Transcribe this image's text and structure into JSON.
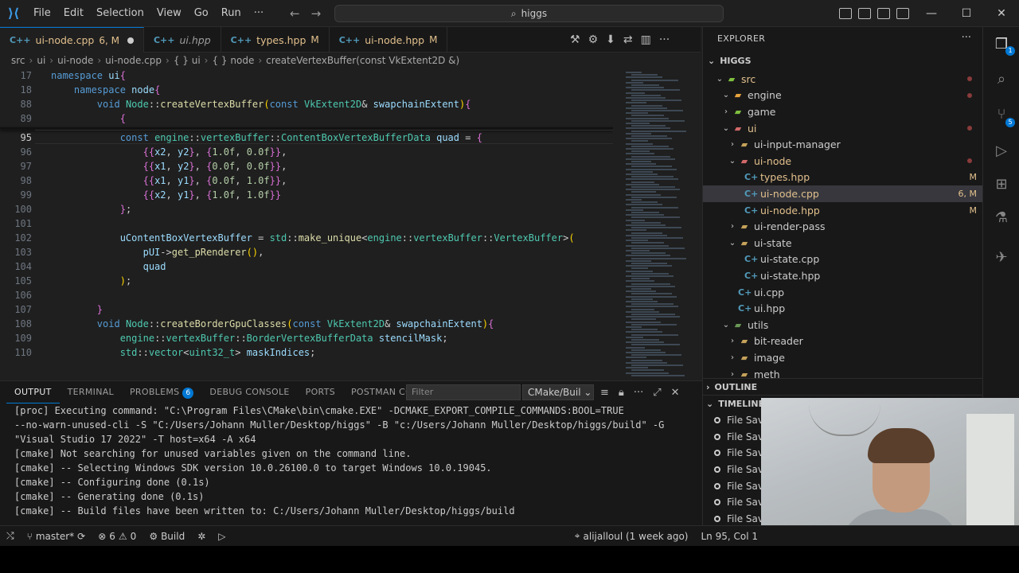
{
  "titlebar": {
    "menu": [
      "File",
      "Edit",
      "Selection",
      "View",
      "Go",
      "Run",
      "···"
    ],
    "search": "higgs"
  },
  "tabs": [
    {
      "label": "ui-node.cpp",
      "badge": "6, M",
      "icon": "C++",
      "active": true,
      "dirty": true
    },
    {
      "label": "ui.hpp",
      "badge": "",
      "icon": "C++",
      "active": false,
      "italic": true
    },
    {
      "label": "types.hpp",
      "badge": "M",
      "icon": "C++",
      "active": false
    },
    {
      "label": "ui-node.hpp",
      "badge": "M",
      "icon": "C++",
      "active": false
    }
  ],
  "breadcrumb": [
    "src",
    "ui",
    "ui-node",
    "ui-node.cpp",
    "{ } ui",
    "{ } node",
    "createVertexBuffer(const VkExtent2D &)"
  ],
  "editor": {
    "lines": [
      {
        "n": "17",
        "t": "namespace ui{"
      },
      {
        "n": "18",
        "t": "    namespace node{"
      },
      {
        "n": "88",
        "t": "        void Node::createVertexBuffer(const VkExtent2D& swapchainExtent){"
      },
      {
        "n": "89",
        "t": "            {"
      },
      {
        "n": "95",
        "t": "            const engine::vertexBuffer::ContentBoxVertexBufferData quad = {"
      },
      {
        "n": "96",
        "t": "                {{x2, y2}, {1.0f, 0.0f}},"
      },
      {
        "n": "97",
        "t": "                {{x1, y2}, {0.0f, 0.0f}},"
      },
      {
        "n": "98",
        "t": "                {{x1, y1}, {0.0f, 1.0f}},"
      },
      {
        "n": "99",
        "t": "                {{x2, y1}, {1.0f, 1.0f}}"
      },
      {
        "n": "100",
        "t": "            };"
      },
      {
        "n": "101",
        "t": ""
      },
      {
        "n": "102",
        "t": "            uContentBoxVertexBuffer = std::make_unique<engine::vertexBuffer::VertexBuffer>("
      },
      {
        "n": "103",
        "t": "                pUI->get_pRenderer(),"
      },
      {
        "n": "104",
        "t": "                quad"
      },
      {
        "n": "105",
        "t": "            );"
      },
      {
        "n": "106",
        "t": ""
      },
      {
        "n": "107",
        "t": "        }"
      },
      {
        "n": "108",
        "t": "        void Node::createBorderGpuClasses(const VkExtent2D& swapchainExtent){"
      },
      {
        "n": "109",
        "t": "            engine::vertexBuffer::BorderVertexBufferData stencilMask;"
      },
      {
        "n": "110",
        "t": "            std::vector<uint32_t> maskIndices;"
      }
    ]
  },
  "panel": {
    "tabs": [
      {
        "label": "OUTPUT",
        "active": true
      },
      {
        "label": "TERMINAL"
      },
      {
        "label": "PROBLEMS",
        "badge": "6"
      },
      {
        "label": "DEBUG CONSOLE"
      },
      {
        "label": "PORTS"
      },
      {
        "label": "POSTMAN CONSOLE"
      }
    ],
    "filter_placeholder": "Filter",
    "channel": "CMake/Buil",
    "output": [
      "[proc] Executing command: \"C:\\Program Files\\CMake\\bin\\cmake.EXE\" -DCMAKE_EXPORT_COMPILE_COMMANDS:BOOL=TRUE",
      "--no-warn-unused-cli -S \"C:/Users/Johann Muller/Desktop/higgs\" -B \"c:/Users/Johann Muller/Desktop/higgs/build\" -G",
      "\"Visual Studio 17 2022\" -T host=x64 -A x64",
      "[cmake] Not searching for unused variables given on the command line.",
      "[cmake] -- Selecting Windows SDK version 10.0.26100.0 to target Windows 10.0.19045.",
      "[cmake] -- Configuring done (0.1s)",
      "[cmake] -- Generating done (0.1s)",
      "[cmake] -- Build files have been written to: C:/Users/Johann Muller/Desktop/higgs/build"
    ]
  },
  "explorer": {
    "header": "EXPLORER",
    "root": "HIGGS",
    "tree": [
      {
        "label": "src",
        "kind": "folder",
        "depth": 1,
        "open": true,
        "dot": true
      },
      {
        "label": "engine",
        "kind": "folder",
        "depth": 2,
        "open": true,
        "dot": true
      },
      {
        "label": "game",
        "kind": "folder",
        "depth": 2,
        "open": false
      },
      {
        "label": "ui",
        "kind": "folder",
        "depth": 2,
        "open": true,
        "dot": true
      },
      {
        "label": "ui-input-manager",
        "kind": "folder",
        "depth": 3,
        "open": false
      },
      {
        "label": "ui-node",
        "kind": "folder",
        "depth": 3,
        "open": true,
        "dot": true
      },
      {
        "label": "types.hpp",
        "kind": "file",
        "depth": 4,
        "badge": "M"
      },
      {
        "label": "ui-node.cpp",
        "kind": "file",
        "depth": 4,
        "badge": "6, M",
        "selected": true
      },
      {
        "label": "ui-node.hpp",
        "kind": "file",
        "depth": 4,
        "badge": "M"
      },
      {
        "label": "ui-render-pass",
        "kind": "folder",
        "depth": 3,
        "open": false
      },
      {
        "label": "ui-state",
        "kind": "folder",
        "depth": 3,
        "open": true
      },
      {
        "label": "ui-state.cpp",
        "kind": "file",
        "depth": 4
      },
      {
        "label": "ui-state.hpp",
        "kind": "file",
        "depth": 4
      },
      {
        "label": "ui.cpp",
        "kind": "file",
        "depth": 3
      },
      {
        "label": "ui.hpp",
        "kind": "file",
        "depth": 3
      },
      {
        "label": "utils",
        "kind": "folder",
        "depth": 2,
        "open": true
      },
      {
        "label": "bit-reader",
        "kind": "folder",
        "depth": 3,
        "open": false
      },
      {
        "label": "image",
        "kind": "folder",
        "depth": 3,
        "open": false
      },
      {
        "label": "meth",
        "kind": "folder",
        "depth": 3,
        "open": false
      }
    ],
    "outline": "OUTLINE",
    "timeline": "TIMELINE",
    "timeline_items": [
      "File Save",
      "File Save",
      "File Save",
      "File Save",
      "File Save",
      "File Save",
      "File Save"
    ]
  },
  "statusbar": {
    "branch": "master*",
    "errors": "6",
    "warnings": "0",
    "build": "Build",
    "blame": "alijalloul (1 week ago)",
    "position": "Ln 95, Col 1"
  },
  "activity_badges": {
    "explorer": "1",
    "scm": "5"
  },
  "colors": {
    "accent": "#0078d4",
    "modified": "#e2c08d",
    "keyword": "#569cd6",
    "type": "#4ec9b0",
    "function": "#dcdcaa"
  }
}
